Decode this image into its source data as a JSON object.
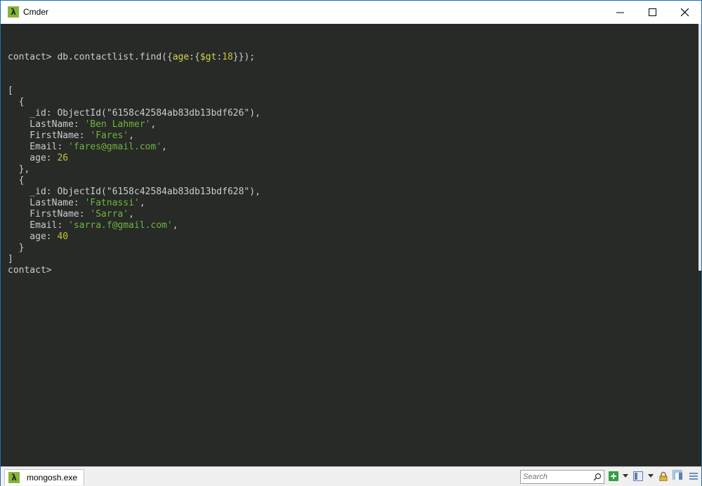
{
  "window": {
    "title": "Cmder",
    "app_icon_glyph": "λ"
  },
  "terminal": {
    "command_line": [
      {
        "t": "contact> db.contactlist.find({",
        "c": ""
      },
      {
        "t": "age",
        "c": "y"
      },
      {
        "t": ":{",
        "c": ""
      },
      {
        "t": "$gt",
        "c": "y"
      },
      {
        "t": ":",
        "c": ""
      },
      {
        "t": "18",
        "c": "n"
      },
      {
        "t": "}});",
        "c": ""
      }
    ],
    "lines": [
      [
        {
          "t": "[",
          "c": ""
        }
      ],
      [
        {
          "t": "  {",
          "c": ""
        }
      ],
      [
        {
          "t": "    _id: ObjectId(\"6158c42584ab83db13bdf626\"),",
          "c": ""
        }
      ],
      [
        {
          "t": "    LastName: ",
          "c": ""
        },
        {
          "t": "'Ben Lahmer'",
          "c": "g"
        },
        {
          "t": ",",
          "c": ""
        }
      ],
      [
        {
          "t": "    FirstName: ",
          "c": ""
        },
        {
          "t": "'Fares'",
          "c": "g"
        },
        {
          "t": ",",
          "c": ""
        }
      ],
      [
        {
          "t": "    Email: ",
          "c": ""
        },
        {
          "t": "'fares@gmail.com'",
          "c": "g"
        },
        {
          "t": ",",
          "c": ""
        }
      ],
      [
        {
          "t": "    age: ",
          "c": ""
        },
        {
          "t": "26",
          "c": "n"
        }
      ],
      [
        {
          "t": "  },",
          "c": ""
        }
      ],
      [
        {
          "t": "  {",
          "c": ""
        }
      ],
      [
        {
          "t": "    _id: ObjectId(\"6158c42584ab83db13bdf628\"),",
          "c": ""
        }
      ],
      [
        {
          "t": "    LastName: ",
          "c": ""
        },
        {
          "t": "'Fatnassi'",
          "c": "g"
        },
        {
          "t": ",",
          "c": ""
        }
      ],
      [
        {
          "t": "    FirstName: ",
          "c": ""
        },
        {
          "t": "'Sarra'",
          "c": "g"
        },
        {
          "t": ",",
          "c": ""
        }
      ],
      [
        {
          "t": "    Email: ",
          "c": ""
        },
        {
          "t": "'sarra.f@gmail.com'",
          "c": "g"
        },
        {
          "t": ",",
          "c": ""
        }
      ],
      [
        {
          "t": "    age: ",
          "c": ""
        },
        {
          "t": "40",
          "c": "n"
        }
      ],
      [
        {
          "t": "  }",
          "c": ""
        }
      ],
      [
        {
          "t": "]",
          "c": ""
        }
      ],
      [
        {
          "t": "contact> ",
          "c": ""
        }
      ]
    ]
  },
  "statusbar": {
    "tab_label": "mongosh.exe",
    "search_placeholder": "Search"
  },
  "colors": {
    "background": "#272a27",
    "text": "#cccccc",
    "key_yellow": "#d6d645",
    "string_green": "#6fb43f",
    "number": "#c6c636",
    "accent_icon": "#86b43a"
  },
  "icons": [
    "lambda-icon",
    "minimize-icon",
    "maximize-icon",
    "close-icon",
    "search-icon",
    "add-tab-icon",
    "layout-icon",
    "lock-icon",
    "split-view-icon",
    "menu-icon"
  ]
}
